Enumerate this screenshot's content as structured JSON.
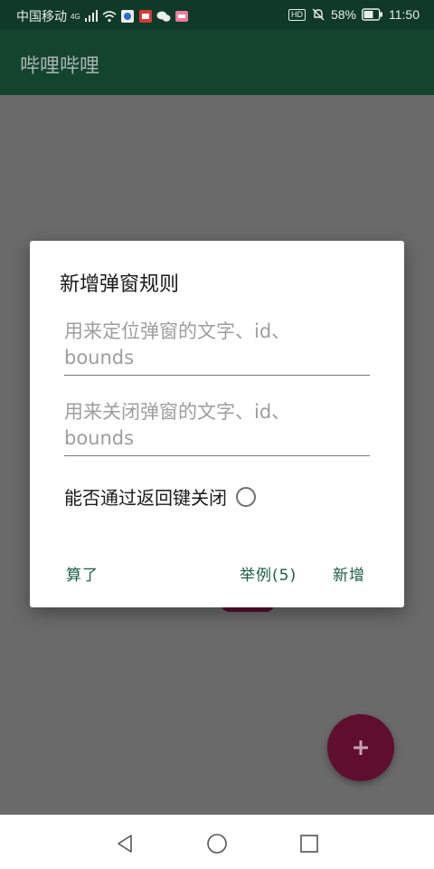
{
  "status_bar": {
    "carrier": "中国移动",
    "network": "4G",
    "hd": "HD",
    "battery": "58%",
    "time": "11:50"
  },
  "app_bar": {
    "title": "哔哩哔哩"
  },
  "dialog": {
    "title": "新增弹窗规则",
    "locate_placeholder": "用来定位弹窗的文字、id、\nbounds",
    "close_placeholder": "用来关闭弹窗的文字、id、\nbounds",
    "back_key_label": "能否通过返回键关闭",
    "buttons": {
      "cancel": "算了",
      "example": "举例(5)",
      "add": "新增"
    }
  },
  "fab": {
    "icon": "plus-icon"
  },
  "nav": {
    "back": "back-icon",
    "home": "home-icon",
    "recents": "recents-icon"
  },
  "colors": {
    "accent": "#1b5e44",
    "fab": "#5f0e2f",
    "app_bar": "#13442e"
  }
}
